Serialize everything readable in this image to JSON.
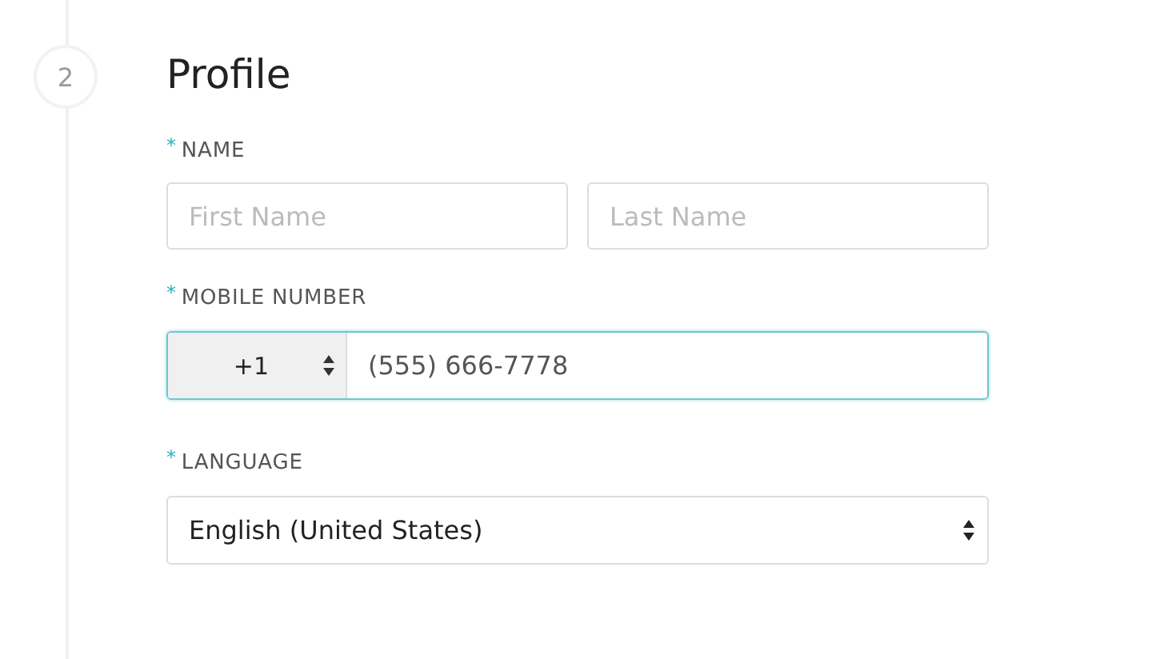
{
  "step": {
    "number": "2"
  },
  "title": "Profile",
  "name_field": {
    "label": "NAME",
    "required_mark": "*",
    "inputs": [
      {
        "placeholder": "First Name"
      },
      {
        "placeholder": "Last Name"
      }
    ]
  },
  "mobile_field": {
    "label": "MOBILE NUMBER",
    "required_mark": "*",
    "country_code": "+1",
    "value": "(555) 666-7778",
    "focused": true
  },
  "language_field": {
    "label": "LANGUAGE",
    "required_mark": "*",
    "value": "English (United States)"
  }
}
